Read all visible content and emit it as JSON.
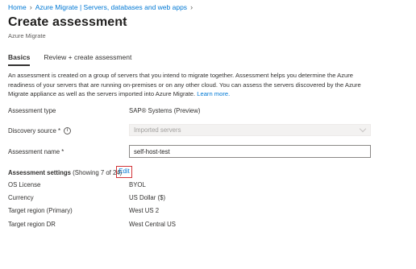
{
  "breadcrumb": {
    "items": [
      "Home",
      "Azure Migrate | Servers, databases and web apps"
    ]
  },
  "header": {
    "title": "Create assessment",
    "subtitle": "Azure Migrate",
    "more_icon": "ellipsis-icon"
  },
  "tabs": [
    {
      "label": "Basics",
      "active": true
    },
    {
      "label": "Review + create assessment",
      "active": false
    }
  ],
  "description": {
    "text": "An assessment is created on a group of servers that you intend to migrate together. Assessment helps you determine the Azure readiness of your servers that are running on-premises or on any other cloud. You can assess the servers discovered by the Azure Migrate appliance as well as the servers imported into Azure Migrate.",
    "link": "Learn more."
  },
  "form": {
    "assessment_type_label": "Assessment type",
    "assessment_type_value": "SAP® Systems (Preview)",
    "discovery_source_label": "Discovery source *",
    "discovery_source_value": "Imported servers",
    "assessment_name_label": "Assessment name *",
    "assessment_name_value": "self-host-test"
  },
  "settings": {
    "header_bold": "Assessment settings",
    "header_count": "(Showing 7 of 24)",
    "edit_label": "Edit",
    "rows": [
      {
        "label": "OS License",
        "value": "BYOL"
      },
      {
        "label": "Currency",
        "value": "US Dollar ($)"
      },
      {
        "label": "Target region (Primary)",
        "value": "West US 2"
      },
      {
        "label": "Target region DR",
        "value": "West Central US"
      }
    ]
  },
  "colors": {
    "link": "#0078d4",
    "highlight_border": "#d13438"
  }
}
